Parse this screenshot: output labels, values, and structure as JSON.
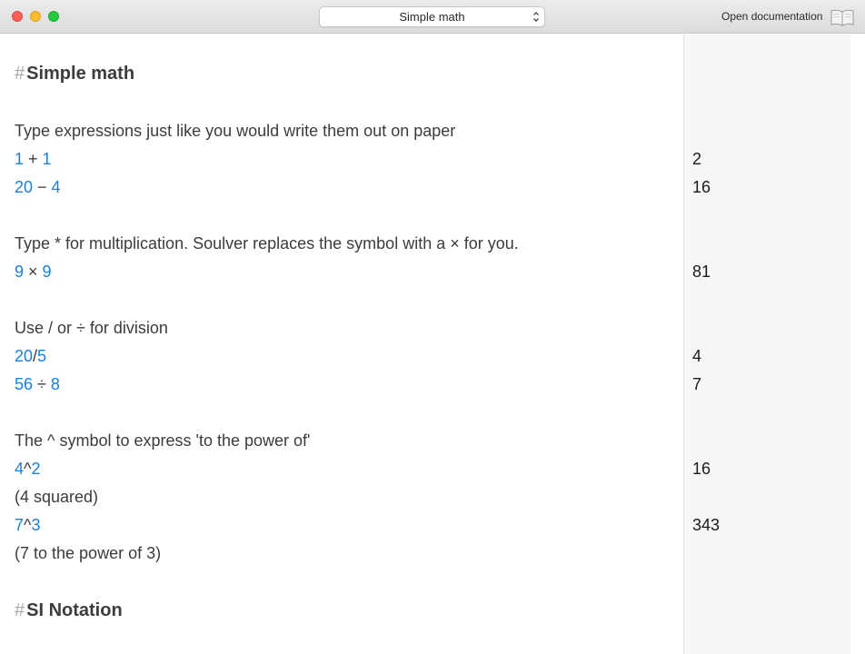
{
  "window": {
    "document_select": "Simple math",
    "open_documentation_label": "Open documentation"
  },
  "sheet": {
    "heading1": "Simple math",
    "heading2": "SI Notation",
    "comment_intro": "Type expressions just like you would write them out on paper",
    "comment_multiply": "Type * for multiplication. Soulver replaces the symbol with a × for you.",
    "comment_divide": "Use / or ÷ for division",
    "comment_power": "The ^ symbol to express 'to the power of'",
    "note_squared": "(4 squared)",
    "note_cubed": "(7 to the power of 3)",
    "expressions": [
      {
        "a": "1",
        "op": " + ",
        "b": "1",
        "result": "2"
      },
      {
        "a": "20",
        "op": " − ",
        "b": "4",
        "result": "16"
      },
      {
        "a": "9",
        "op": " × ",
        "b": "9",
        "result": "81"
      },
      {
        "a": "20",
        "op": "/",
        "b": "5",
        "result": "4"
      },
      {
        "a": "56",
        "op": " ÷ ",
        "b": "8",
        "result": "7"
      },
      {
        "a": "4",
        "op": "^",
        "b": "2",
        "result": "16"
      },
      {
        "a": "7",
        "op": "^",
        "b": "3",
        "result": "343"
      }
    ]
  },
  "colors": {
    "number": "#1a7fd6",
    "heading_hash": "#a8a8a8",
    "results_background": "#f6f6f6"
  },
  "icons": [
    "close-button",
    "minimize-button",
    "zoom-button",
    "chevron-updown-icon",
    "book-icon"
  ]
}
